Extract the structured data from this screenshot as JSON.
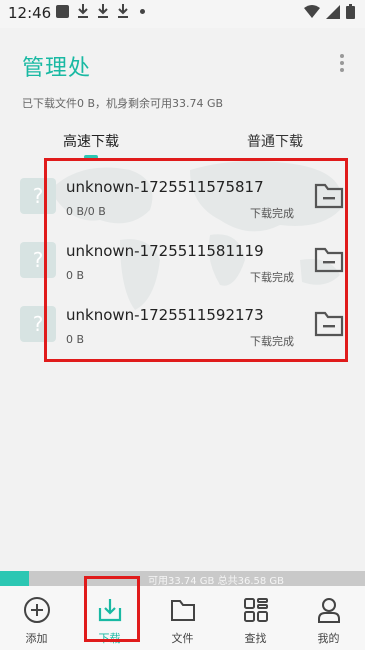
{
  "status_bar": {
    "time": "12:46"
  },
  "header": {
    "title": "管理处",
    "storage_info": "已下载文件0 B，机身剩余可用33.74 GB"
  },
  "tabs": [
    {
      "label": "高速下载",
      "active": true
    },
    {
      "label": "普通下载",
      "active": false
    }
  ],
  "downloads": [
    {
      "name": "unknown-1725511575817",
      "size": "0 B/0 B",
      "status": "下载完成"
    },
    {
      "name": "unknown-1725511581119",
      "size": "0 B",
      "status": "下载完成"
    },
    {
      "name": "unknown-1725511592173",
      "size": "0 B",
      "status": "下载完成"
    }
  ],
  "file_icon_glyph": "?",
  "storage_bar": {
    "text": "可用33.74 GB 总共36.58 GB",
    "used_fraction": 0.08
  },
  "nav": [
    {
      "label": "添加",
      "icon": "plus-circle-icon",
      "active": false
    },
    {
      "label": "下载",
      "icon": "download-tray-icon",
      "active": true
    },
    {
      "label": "文件",
      "icon": "folder-icon",
      "active": false
    },
    {
      "label": "查找",
      "icon": "apps-grid-icon",
      "active": false
    },
    {
      "label": "我的",
      "icon": "person-icon",
      "active": false
    }
  ],
  "colors": {
    "accent": "#19b9a3",
    "highlight": "#e01b1b"
  }
}
